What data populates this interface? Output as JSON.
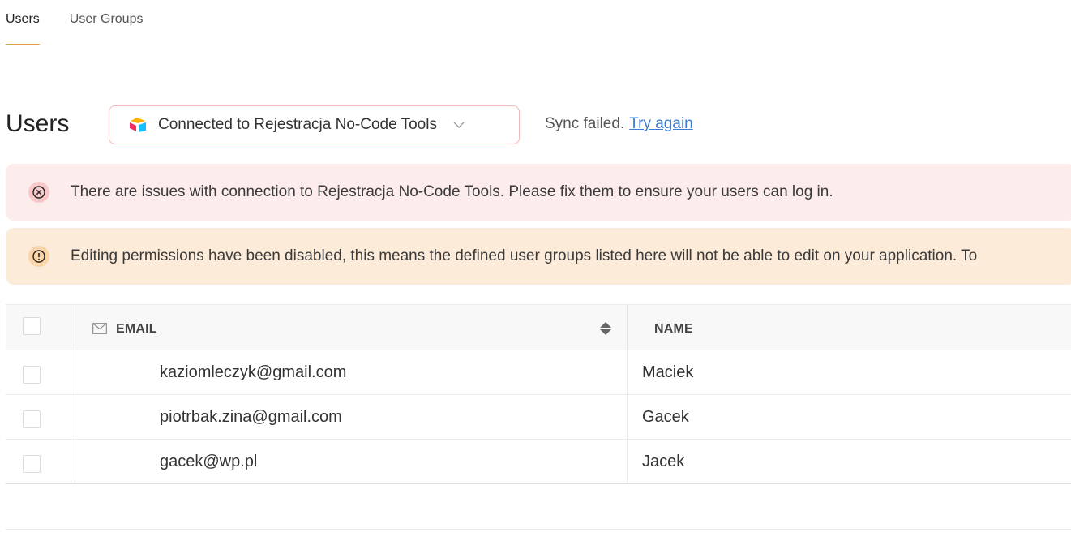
{
  "tabs": [
    {
      "label": "Users",
      "active": true
    },
    {
      "label": "User Groups",
      "active": false
    }
  ],
  "header": {
    "title": "Users",
    "connection_label": "Connected to Rejestracja No-Code Tools",
    "sync_status": "Sync failed.",
    "retry_label": "Try again"
  },
  "banners": {
    "error": "There are issues with connection to Rejestracja No-Code Tools. Please fix them to ensure your users can log in.",
    "warning": "Editing permissions have been disabled, this means the defined user groups listed here will not be able to edit on your application. To"
  },
  "table": {
    "columns": {
      "email": "EMAIL",
      "name": "NAME"
    },
    "rows": [
      {
        "email": "kaziomleczyk@gmail.com",
        "name": "Maciek"
      },
      {
        "email": "piotrbak.zina@gmail.com",
        "name": "Gacek"
      },
      {
        "email": "gacek@wp.pl",
        "name": "Jacek"
      }
    ]
  },
  "colors": {
    "accent": "#e3a24a",
    "error_bg": "#fdecec",
    "warning_bg": "#fdebd9",
    "link": "#3a7bd5"
  },
  "icons": {
    "connection": "airtable-logo-icon",
    "error": "x-circle-icon",
    "warning": "exclamation-circle-icon",
    "email_column": "envelope-icon",
    "sort": "sort-icon"
  }
}
